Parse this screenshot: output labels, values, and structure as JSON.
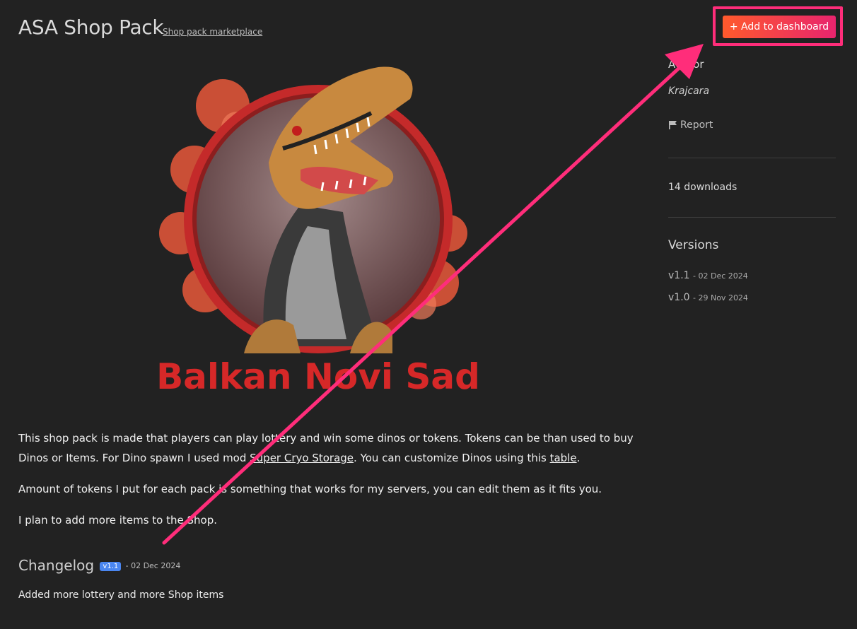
{
  "header": {
    "title": "ASA Shop Pack",
    "subtitle_link": "Shop pack marketplace",
    "add_button": "+ Add to dashboard"
  },
  "sidebar": {
    "author_heading": "Author",
    "author_name": "Krajcara",
    "report_label": "Report",
    "downloads": "14 downloads",
    "versions_title": "Versions",
    "versions": [
      {
        "version": "v1.1",
        "date": "- 02 Dec 2024"
      },
      {
        "version": "v1.0",
        "date": "- 29 Nov 2024"
      }
    ]
  },
  "hero": {
    "logo_text": "Balkan Novi Sad"
  },
  "description": {
    "p1_a": "This shop pack is made that players can play lottery and win some dinos or tokens. Tokens can be than used to buy Dinos or Items. For Dino spawn I used mod ",
    "p1_link1": "Super Cryo Storage",
    "p1_b": ". You can customize Dinos using this ",
    "p1_link2": "table",
    "p1_c": ".",
    "p2": "Amount of tokens I put for each pack is something that works for my servers, you can edit them as it fits you.",
    "p3": "I plan to add more items to the Shop."
  },
  "changelog": {
    "title": "Changelog",
    "badge": "v1.1",
    "date": "- 02 Dec 2024",
    "body": "Added more lottery and more Shop items"
  },
  "colors": {
    "background": "#222222",
    "accent_start": "#ff5a2c",
    "accent_end": "#e8246e",
    "annotation": "#ff2d7a",
    "badge": "#4a86f0"
  }
}
